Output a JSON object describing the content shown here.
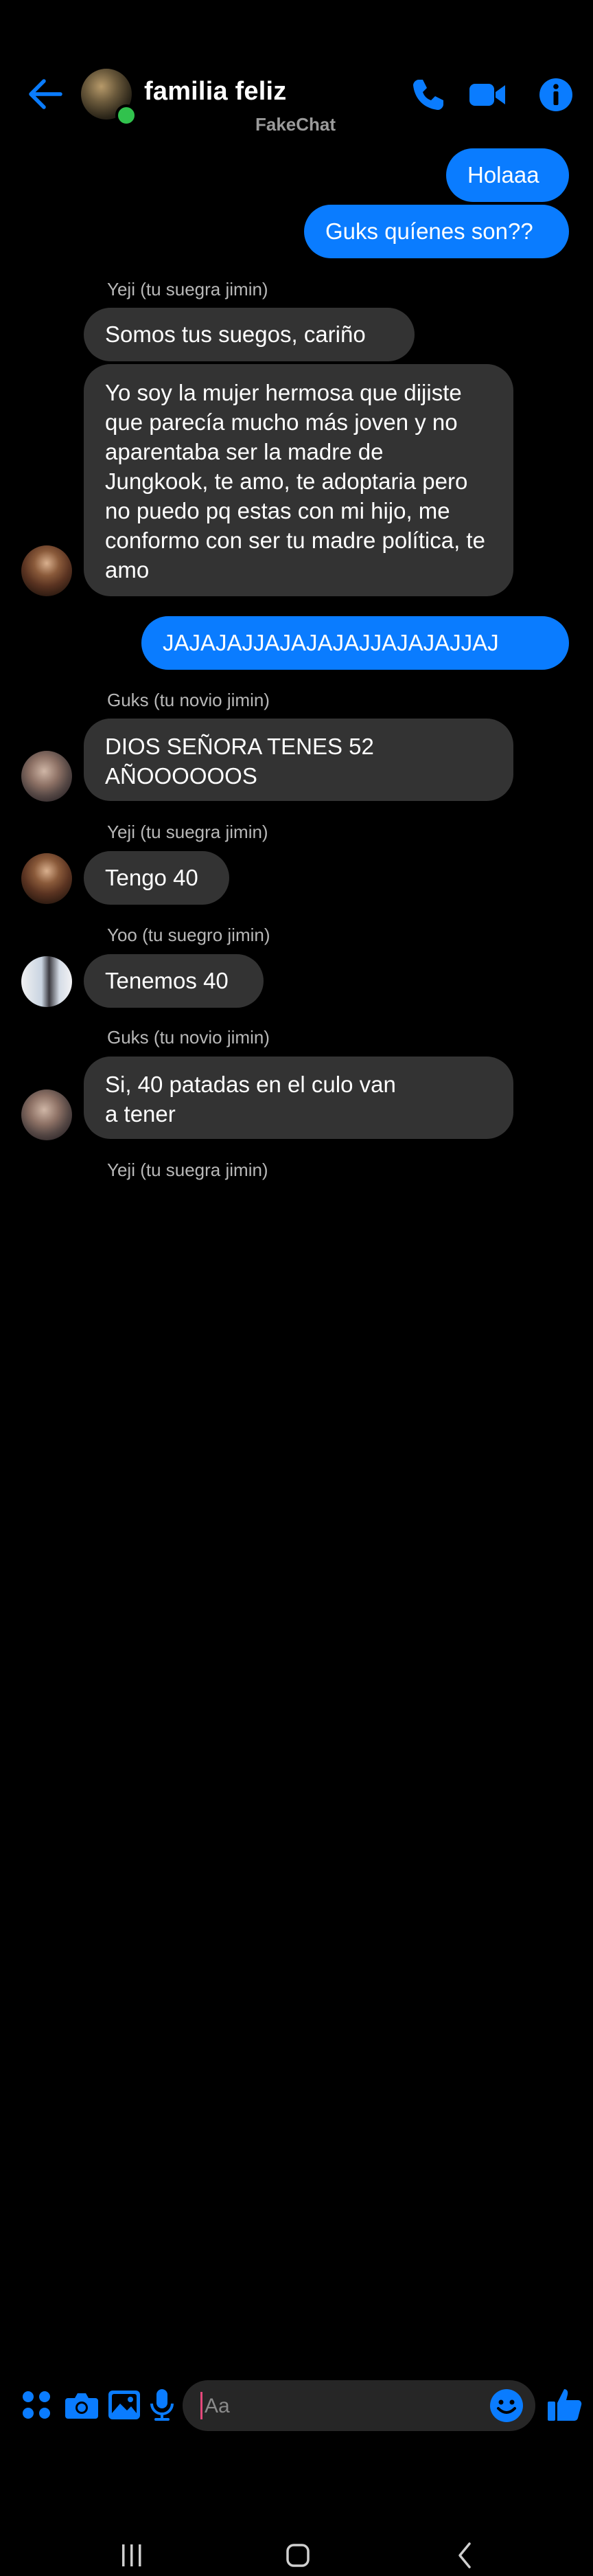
{
  "header": {
    "title": "familia feliz",
    "subtitle": "FakeChat",
    "icons": [
      "back-arrow-icon",
      "phone-icon",
      "video-camera-icon",
      "info-icon"
    ],
    "accent_color": "#0a7cff",
    "online_color": "#31c24d"
  },
  "messages": [
    {
      "direction": "outgoing",
      "text": "Holaaa"
    },
    {
      "direction": "outgoing",
      "text": "Guks quíenes son??"
    },
    {
      "direction": "incoming",
      "sender": "Yeji (tu suegra jimin)",
      "text": "Somos tus suegos, cariño"
    },
    {
      "direction": "incoming",
      "sender": "Yeji (tu suegra jimin)",
      "text": "Yo soy la mujer hermosa que dijiste que parecía mucho más joven y no aparentaba ser la madre de Jungkook, te amo, te adoptaria pero no puedo pq estas con mi hijo, me conformo con ser tu madre política, te amo"
    },
    {
      "direction": "outgoing",
      "text": "JAJAJAJJAJAJAJAJJAJAJAJJAJ"
    },
    {
      "direction": "incoming",
      "sender": "Guks (tu novio jimin)",
      "text": "DIOS SEÑORA TENES 52 AÑOOOOOOS"
    },
    {
      "direction": "incoming",
      "sender": "Yeji (tu suegra jimin)",
      "text": "Tengo 40"
    },
    {
      "direction": "incoming",
      "sender": "Yoo (tu suegro jimin)",
      "text": "Tenemos 40"
    },
    {
      "direction": "incoming",
      "sender": "Guks (tu novio jimin)",
      "text": "Si, 40 patadas en el culo van a tener"
    },
    {
      "direction": "incoming",
      "sender": "Yeji (tu suegra jimin)",
      "text": ""
    }
  ],
  "composer": {
    "placeholder": "Aa",
    "icons": [
      "apps-grid-icon",
      "camera-icon",
      "gallery-icon",
      "microphone-icon",
      "emoji-icon",
      "thumbs-up-icon"
    ]
  },
  "navbar": {
    "icons": [
      "recent-apps-icon",
      "home-icon",
      "back-icon"
    ]
  }
}
